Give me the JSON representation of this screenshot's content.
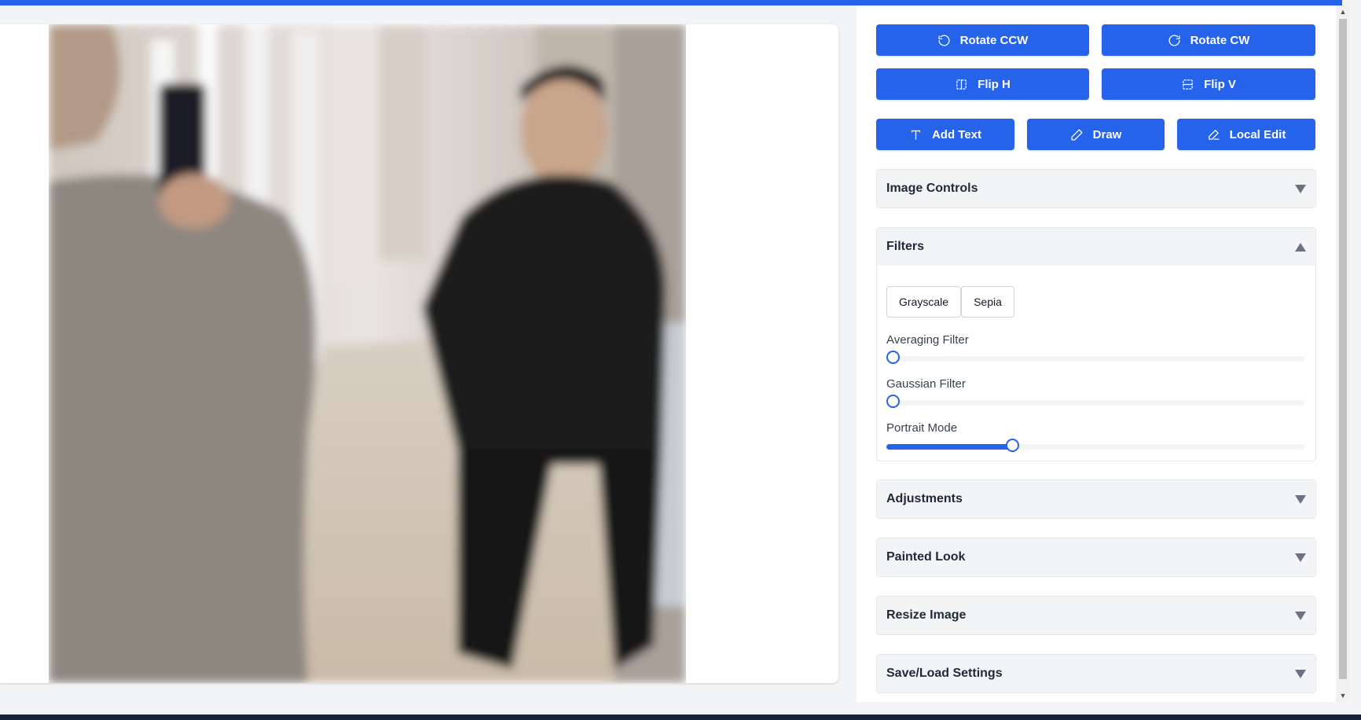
{
  "toolbar": {
    "rotate_ccw": "Rotate CCW",
    "rotate_cw": "Rotate CW",
    "flip_h": "Flip H",
    "flip_v": "Flip V",
    "add_text": "Add Text",
    "draw": "Draw",
    "local_edit": "Local Edit"
  },
  "panels": {
    "image_controls": "Image Controls",
    "filters": "Filters",
    "adjustments": "Adjustments",
    "painted_look": "Painted Look",
    "resize_image": "Resize Image",
    "save_load": "Save/Load Settings"
  },
  "filters": {
    "grayscale": "Grayscale",
    "sepia": "Sepia",
    "averaging_label": "Averaging Filter",
    "averaging_value": 0,
    "gaussian_label": "Gaussian Filter",
    "gaussian_value": 0,
    "portrait_label": "Portrait Mode",
    "portrait_value": 0.3
  },
  "colors": {
    "accent": "#2563eb",
    "panel_header": "#f3f4f6"
  }
}
